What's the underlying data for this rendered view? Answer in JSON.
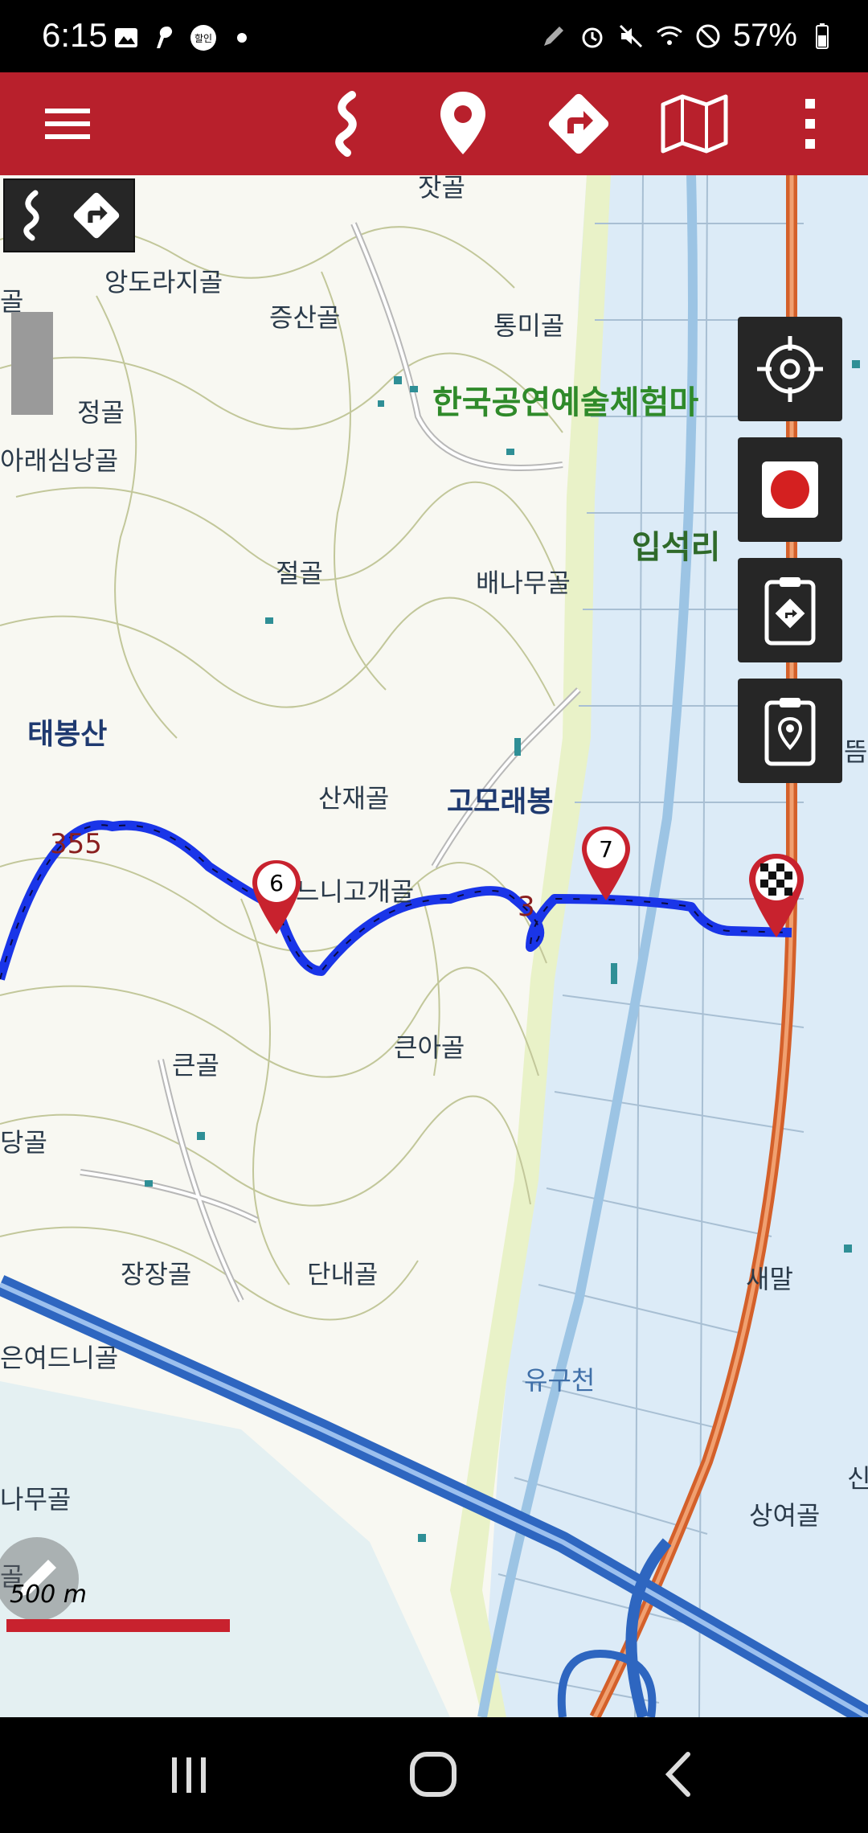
{
  "status_bar": {
    "time": "6:15",
    "badge": "할인",
    "battery": "57%"
  },
  "toolbar": {
    "icons": [
      "menu-icon",
      "route-icon",
      "place-pin-icon",
      "directions-icon",
      "map-icon",
      "more-vert-icon"
    ]
  },
  "map_labels": {
    "jae": "잣골",
    "andorajigol": "앙도라지골",
    "jeungsangol": "증산골",
    "tongmigol": "통미골",
    "museum": "한국공연예술체험마",
    "jeonggol": "정골",
    "araesimnanggol": "아래심낭골",
    "ipseokri": "입석리",
    "jeolgol": "절골",
    "baenamugol": "배나무골",
    "taebongsan": "태봉산",
    "sanjaegol": "산재골",
    "gomoraebong": "고모래봉",
    "peak355": "355",
    "eodinigogae": "느니고개골",
    "keungol": "큰골",
    "keunagol": "큰아골",
    "dangol": "당골",
    "jangjanggol": "장장골",
    "dannaegol": "단내골",
    "saemal": "새말",
    "euneodeunigol": "은여드니골",
    "yugucheon": "유구천",
    "namugol": "나무골",
    "sangyeogol": "상여골",
    "peak3": "3",
    "gol": "골",
    "ddeum": "뜸",
    "sin": "신",
    "gol2": "골"
  },
  "markers": {
    "waypoint6": "6",
    "waypoint7": "7"
  },
  "scale": {
    "label": "500 m"
  },
  "colors": {
    "toolbar": "#b8202c",
    "track": "#1a35e8",
    "fab_bg": "#262626",
    "scale": "#c8222e"
  }
}
